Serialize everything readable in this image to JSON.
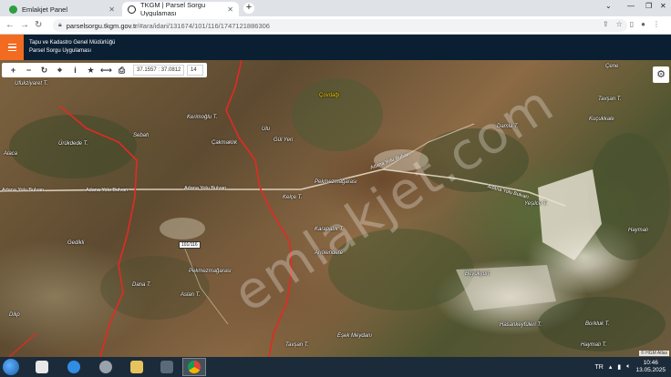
{
  "browser": {
    "tabs": [
      {
        "title": "Emlakjet Panel",
        "icon": "emlakjet-favicon"
      },
      {
        "title": "TKGM | Parsel Sorgu Uygulaması",
        "icon": "tkgm-favicon"
      }
    ],
    "new_tab_label": "+",
    "url_host": "parselsorgu.tkgm.gov.tr",
    "url_path": "/#ara/idari/131674/101/116/1747121886306"
  },
  "app": {
    "title_line1": "Tapu ve Kadastro Genel Müdürlüğü",
    "title_line2": "Parsel Sorgu Uygulaması"
  },
  "map_toolbar": {
    "coordinates": "37.1557 : 37.0812",
    "zoom": "14"
  },
  "map": {
    "watermark": "emlakjet.com",
    "parcel_tag": "101/116",
    "attribution": "© HGM Atlas",
    "labels": [
      {
        "text": "Ufukziyaret T.",
        "style": "white"
      },
      {
        "text": "Çovdağı",
        "style": "yellow"
      },
      {
        "text": "Çene",
        "style": "white"
      },
      {
        "text": "Tavşan T.",
        "style": "white"
      },
      {
        "text": "Kuçukkale",
        "style": "white"
      },
      {
        "text": "Ürükdede T.",
        "style": "white"
      },
      {
        "text": "Sebah",
        "style": "white"
      },
      {
        "text": "Kerimoğlu T.",
        "style": "white"
      },
      {
        "text": "Ulu",
        "style": "white"
      },
      {
        "text": "Gül Yeri",
        "style": "white"
      },
      {
        "text": "Çakmaklık",
        "style": "white"
      },
      {
        "text": "Damla T.",
        "style": "white"
      },
      {
        "text": "Pekmezmağarası",
        "style": "white"
      },
      {
        "text": "Kelçe T.",
        "style": "white"
      },
      {
        "text": "Yeşilce T.",
        "style": "white"
      },
      {
        "text": "Karapatık T.",
        "style": "white"
      },
      {
        "text": "Arıölendere",
        "style": "white"
      },
      {
        "text": "Haymalı",
        "style": "white"
      },
      {
        "text": "Büyükyurt",
        "style": "white"
      },
      {
        "text": "Gedikli",
        "style": "white"
      },
      {
        "text": "Pekmezmağarası",
        "style": "white"
      },
      {
        "text": "Dana T.",
        "style": "white"
      },
      {
        "text": "Aslan T.",
        "style": "white"
      },
      {
        "text": "Hasankeyfüleri T.",
        "style": "white"
      },
      {
        "text": "Borkluk T.",
        "style": "white"
      },
      {
        "text": "Eşek Meydanı",
        "style": "white"
      },
      {
        "text": "Tavşan T.",
        "style": "white"
      },
      {
        "text": "Haymalı T.",
        "style": "white"
      },
      {
        "text": "Alaca",
        "style": "white"
      },
      {
        "text": "Dilip",
        "style": "white"
      }
    ],
    "roads": [
      {
        "text": "Adana Yolu Bulvarı"
      },
      {
        "text": "Adana Yolu Bulvarı"
      },
      {
        "text": "Adana Yolu Bulvarı"
      },
      {
        "text": "Adana Yolu Bulvarı"
      },
      {
        "text": "Adana Yolu Bulvarı"
      }
    ]
  },
  "taskbar": {
    "language": "TR",
    "time": "10:46",
    "date": "13.05.2025"
  },
  "colors": {
    "accent": "#f26b21",
    "header_bg": "#0b1f33",
    "boundary": "#e32a24"
  }
}
